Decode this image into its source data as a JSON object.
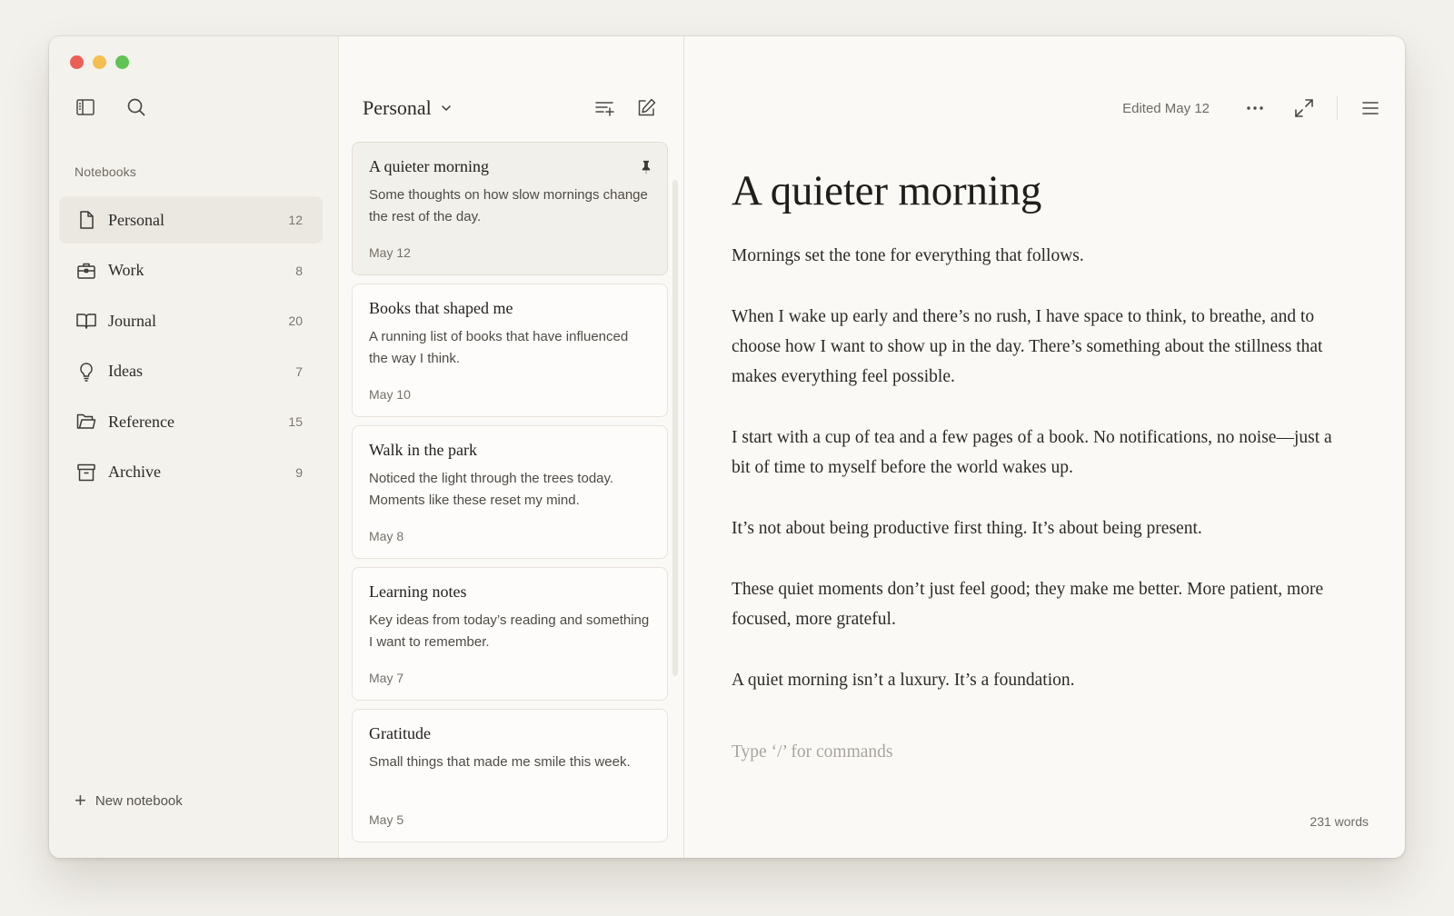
{
  "window": {
    "controls": [
      "close",
      "minimize",
      "zoom"
    ]
  },
  "sidebar": {
    "tools": {
      "toggle_icon": "sidebar-toggle-icon",
      "search_icon": "search-icon"
    },
    "heading": "Notebooks",
    "items": [
      {
        "label": "Personal",
        "count": "12",
        "icon": "document-icon",
        "active": true
      },
      {
        "label": "Work",
        "count": "8",
        "icon": "briefcase-icon",
        "active": false
      },
      {
        "label": "Journal",
        "count": "20",
        "icon": "book-icon",
        "active": false
      },
      {
        "label": "Ideas",
        "count": "7",
        "icon": "lightbulb-icon",
        "active": false
      },
      {
        "label": "Reference",
        "count": "15",
        "icon": "folder-icon",
        "active": false
      },
      {
        "label": "Archive",
        "count": "9",
        "icon": "archive-icon",
        "active": false
      }
    ],
    "new_notebook_label": "New notebook"
  },
  "notes_list": {
    "notebook_title": "Personal",
    "notes": [
      {
        "title": "A quieter morning",
        "snippet": "Some thoughts on how slow mornings change the rest of the day.",
        "date": "May 12",
        "pinned": true,
        "selected": true
      },
      {
        "title": "Books that shaped me",
        "snippet": "A running list of books that have influenced the way I think.",
        "date": "May 10",
        "pinned": false,
        "selected": false
      },
      {
        "title": "Walk in the park",
        "snippet": "Noticed the light through the trees today. Moments like these reset my mind.",
        "date": "May 8",
        "pinned": false,
        "selected": false
      },
      {
        "title": "Learning notes",
        "snippet": "Key ideas from today’s reading and something I want to remember.",
        "date": "May 7",
        "pinned": false,
        "selected": false
      },
      {
        "title": "Gratitude",
        "snippet": "Small things that made me smile this week.",
        "date": "May 5",
        "pinned": false,
        "selected": false
      }
    ]
  },
  "editor": {
    "edited_label": "Edited May 12",
    "title": "A quieter morning",
    "paragraphs": [
      "Mornings set the tone for everything that follows.",
      "When I wake up early and there’s no rush, I have space to think, to breathe, and to choose how I want to show up in the day. There’s something about the stillness that makes everything feel possible.",
      "I start with a cup of tea and a few pages of a book. No notifications, no noise—just a bit of time to myself before the world wakes up.",
      "It’s not about being productive first thing. It’s about being present.",
      "These quiet moments don’t just feel good; they make me better. More patient, more focused, more grateful.",
      "A quiet morning isn’t a luxury. It’s a foundation."
    ],
    "command_placeholder": "Type ‘/’ for commands",
    "word_count": "231 words"
  },
  "colors": {
    "background": "#f3f1ec",
    "sidebar": "#f4f2ed",
    "active_item": "#ebe8e1",
    "close": "#ec5f56",
    "minimize": "#f4bf4f",
    "zoom": "#5fc454"
  }
}
